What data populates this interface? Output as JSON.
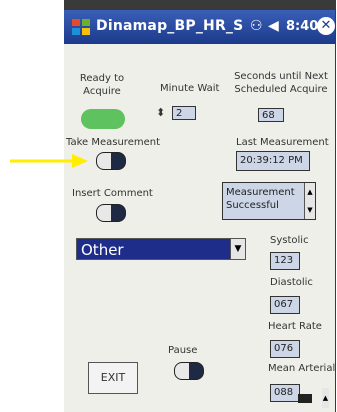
{
  "window": {
    "title": "Dinamap_BP_HR_S",
    "time": "8:40",
    "close_label": "✕"
  },
  "ready": {
    "label": "Ready to Acquire",
    "color": "#5ec25e"
  },
  "minute_wait": {
    "label": "Minute Wait",
    "value": "2"
  },
  "seconds": {
    "label": "Seconds until Next Scheduled Acquire",
    "value": "68"
  },
  "take_measurement": {
    "label": "Take Measurement"
  },
  "last_measurement": {
    "label": "Last Measurement",
    "value": "20:39:12 PM"
  },
  "insert_comment": {
    "label": "Insert Comment"
  },
  "message": {
    "value": "Measurement Successful"
  },
  "dropdown": {
    "selected": "Other"
  },
  "systolic": {
    "label": "Systolic",
    "value": "123"
  },
  "diastolic": {
    "label": "Diastolic",
    "value": "067"
  },
  "heart_rate": {
    "label": "Heart Rate",
    "value": "076"
  },
  "mean_arterial": {
    "label": "Mean Arterial",
    "value": "088"
  },
  "pause": {
    "label": "Pause"
  },
  "exit": {
    "label": "EXIT"
  },
  "colors": {
    "titlebar": "#1c3a8a",
    "field": "#cdd6e6",
    "combo": "#1f2d8a",
    "annotation_arrow": "#ffee00"
  }
}
